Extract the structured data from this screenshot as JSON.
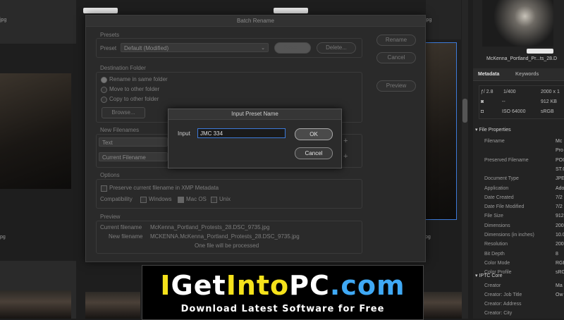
{
  "background": {
    "thumb_labels": [
      "jpg",
      "jpg",
      "pg",
      "pg"
    ]
  },
  "dialog": {
    "title": "Batch Rename",
    "presets": {
      "group_label": "Presets",
      "preset_label": "Preset",
      "preset_value": "Default (Modified)",
      "save_label": "Save...",
      "delete_label": "Delete..."
    },
    "side_buttons": {
      "rename": "Rename",
      "cancel": "Cancel",
      "preview": "Preview"
    },
    "destination": {
      "group_label": "Destination Folder",
      "options": [
        "Rename in same folder",
        "Move to other folder",
        "Copy to other folder"
      ],
      "browse_label": "Browse..."
    },
    "new_filenames": {
      "group_label": "New Filenames",
      "row1": "Text",
      "row2": "Current Filename"
    },
    "options": {
      "group_label": "Options",
      "preserve_label": "Preserve current filename in XMP Metadata",
      "compat_label": "Compatibility",
      "windows": "Windows",
      "macos": "Mac OS",
      "unix": "Unix"
    },
    "preview": {
      "group_label": "Preview",
      "current_label": "Current filename",
      "current_value": "McKenna_Portland_Protests_28.DSC_9735.jpg",
      "new_label": "New filename",
      "new_value": "MCKENNA.McKenna_Portland_Protests_28.DSC_9735.jpg",
      "count_text": "One file will be processed"
    }
  },
  "modal": {
    "title": "Input Preset Name",
    "input_label": "Input",
    "input_value": "JMC 334",
    "ok_label": "OK",
    "cancel_label": "Cancel"
  },
  "right_panel": {
    "thumb_caption": "McKenna_Portland_Pr...ts_28.D",
    "tabs": [
      "Metadata",
      "Keywords"
    ],
    "exif": {
      "aperture": "ƒ/ 2.8",
      "shutter": "1/400",
      "dimensions": "2000 x 1",
      "flash": "--",
      "size": "912 KB",
      "iso": "ISO 64000",
      "color": "sRGB"
    },
    "file_properties_title": "File Properties",
    "file_properties": [
      {
        "label": "Filename",
        "value": "Mc"
      },
      {
        "label": "",
        "value": "Pro"
      },
      {
        "label": "Preserved Filename",
        "value": "POI"
      },
      {
        "label": "",
        "value": "ST.C"
      },
      {
        "label": "Document Type",
        "value": "JPE"
      },
      {
        "label": "Application",
        "value": "Ado"
      },
      {
        "label": "Date Created",
        "value": "7/2"
      },
      {
        "label": "Date File Modified",
        "value": "7/2"
      },
      {
        "label": "File Size",
        "value": "912"
      },
      {
        "label": "Dimensions",
        "value": "200"
      },
      {
        "label": "Dimensions (in inches)",
        "value": "10.0"
      },
      {
        "label": "Resolution",
        "value": "200"
      },
      {
        "label": "Bit Depth",
        "value": "8"
      },
      {
        "label": "Color Mode",
        "value": "RGB"
      },
      {
        "label": "Color Profile",
        "value": "sRGB"
      }
    ],
    "iptc_title": "IPTC Core",
    "iptc": [
      {
        "label": "Creator",
        "value": "Ma"
      },
      {
        "label": "Creator: Job Title",
        "value": "Ow"
      },
      {
        "label": "Creator: Address",
        "value": ""
      },
      {
        "label": "Creator: City",
        "value": ""
      }
    ]
  },
  "banner": {
    "title_i": "I",
    "title_get": "Get",
    "title_into": "Into",
    "title_pc": "PC",
    "title_com": ".com",
    "subtitle": "Download Latest Software for Free",
    "colors": {
      "yellow": "#f5e21b",
      "blue": "#3fa9f5",
      "white": "#ffffff"
    }
  }
}
